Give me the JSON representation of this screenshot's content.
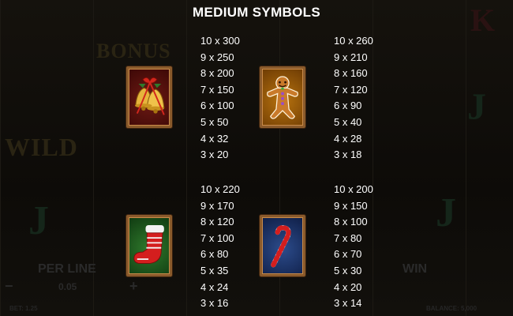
{
  "title": "MEDIUM SYMBOLS",
  "symbols": [
    {
      "icon": "bells-icon",
      "pays": [
        "10 x 300",
        "9 x 250",
        "8 x 200",
        "7 x 150",
        "6 x 100",
        "5 x 50",
        "4 x 32",
        "3 x 20"
      ]
    },
    {
      "icon": "gingerbread-man-icon",
      "pays": [
        "10 x 260",
        "9 x 210",
        "8 x 160",
        "7 x 120",
        "6 x 90",
        "5 x 40",
        "4 x 28",
        "3 x 18"
      ]
    },
    {
      "icon": "christmas-stocking-icon",
      "pays": [
        "10 x 220",
        "9 x 170",
        "8 x 120",
        "7 x 100",
        "6 x 80",
        "5 x 35",
        "4 x 24",
        "3 x 16"
      ]
    },
    {
      "icon": "candy-cane-icon",
      "pays": [
        "10 x 200",
        "9 x 150",
        "8 x 100",
        "7 x 80",
        "6 x 70",
        "5 x 30",
        "4 x 20",
        "3 x 14"
      ]
    }
  ],
  "background": {
    "bonus_label": "BONUS",
    "wild_label": "WILD",
    "per_line_label": "PER LINE",
    "per_line_value": "0.05",
    "win_label": "WIN",
    "bet_label": "BET: 1.25",
    "balance_label": "BALANCE: 5,000",
    "minus_label": "−",
    "plus_label": "+"
  },
  "colors": {
    "frame": "#8a5a2b",
    "text": "#ffffff",
    "background": "#0b0a08"
  }
}
